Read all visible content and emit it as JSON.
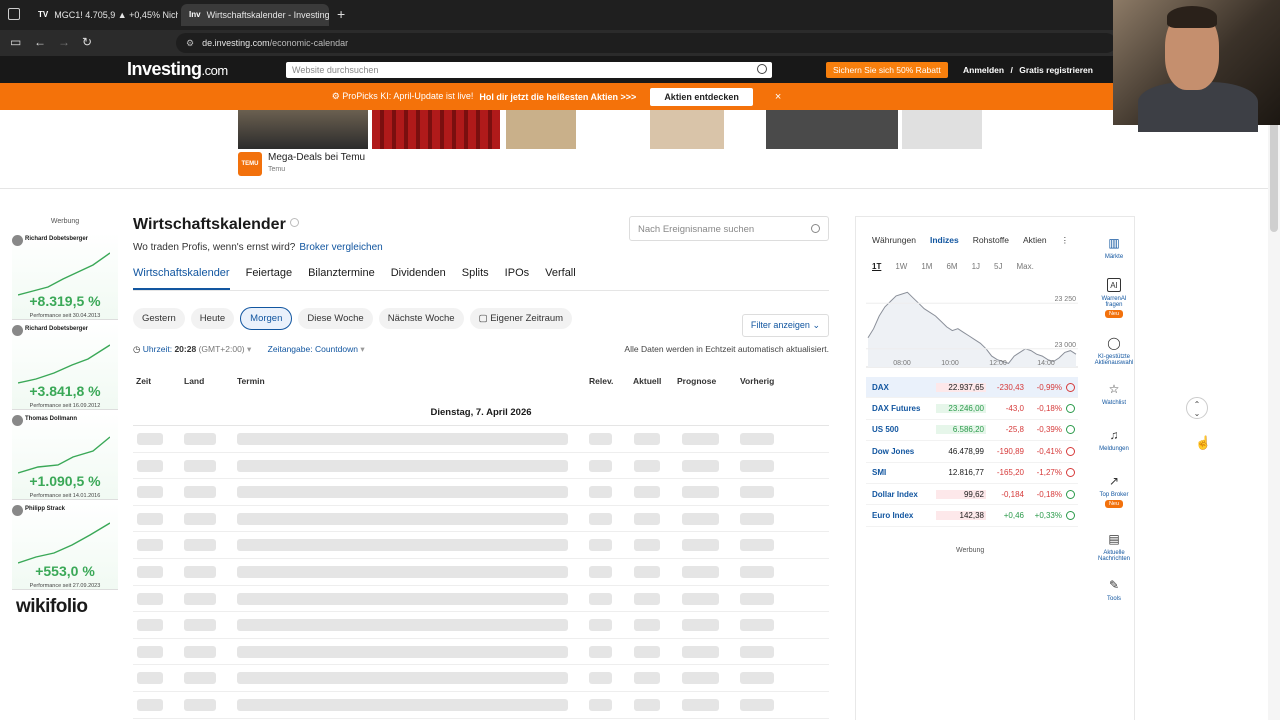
{
  "browser": {
    "tabs": [
      {
        "icon": "favicon-tab1",
        "title": "MGC1! 4.705,9 ▲ +0,45% Nicht"
      },
      {
        "icon": "investing-favicon",
        "title": "Wirtschaftskalender - Investing"
      }
    ],
    "new_tab": "+",
    "url_domain": "de.investing.com",
    "url_path": "/economic-calendar"
  },
  "site": {
    "logo_main": "Investing",
    "logo_suffix": ".com",
    "search_placeholder": "Website durchsuchen",
    "promo_button": "Sichern Sie sich 50% Rabatt",
    "login": "Anmelden",
    "login_sep": "/",
    "register": "Gratis registrieren"
  },
  "banner": {
    "text": "ProPicks KI: April-Update ist live!",
    "bold_text": "Hol dir jetzt die heißesten Aktien >>>",
    "cta": "Aktien entdecken",
    "close": "×"
  },
  "ad_top": {
    "logo_text": "TEMU",
    "title": "Mega-Deals bei Temu",
    "source": "Temu"
  },
  "left_ad": {
    "label": "Werbung",
    "cards": [
      {
        "name": "Richard Dobetsberger",
        "perf": "+8.319,5 %",
        "since": "Performance seit 30.04.2013"
      },
      {
        "name": "Richard Dobetsberger",
        "perf": "+3.841,8 %",
        "since": "Performance seit 16.09.2012"
      },
      {
        "name": "Thomas Dollmann",
        "perf": "+1.090,5 %",
        "since": "Performance seit 14.01.2016"
      },
      {
        "name": "Philipp Strack",
        "perf": "+553,0 %",
        "since": "Performance seit 27.09.2023"
      }
    ],
    "brand": "wikifolio"
  },
  "main": {
    "title": "Wirtschaftskalender",
    "question": "Wo traden Profis, wenn's ernst wird?",
    "broker_link": "Broker vergleichen",
    "search_placeholder": "Nach Ereignisname suchen",
    "subnav": [
      "Wirtschaftskalender",
      "Feiertage",
      "Bilanztermine",
      "Dividenden",
      "Splits",
      "IPOs",
      "Verfall"
    ],
    "date_filters": [
      "Gestern",
      "Heute",
      "Morgen",
      "Diese Woche",
      "Nächste Woche",
      "Eigener Zeitraum"
    ],
    "active_date_filter": "Morgen",
    "filter_button": "Filter anzeigen",
    "time_label": "Uhrzeit:",
    "time_value": "20:28",
    "timezone": "(GMT+2:00)",
    "display_label": "Zeitangabe:",
    "display_value": "Countdown",
    "realtime_note": "Alle Daten werden in Echtzeit automatisch aktualisiert.",
    "columns": [
      "Zeit",
      "Land",
      "Termin",
      "Relev.",
      "Aktuell",
      "Prognose",
      "Vorherig"
    ],
    "date_header": "Dienstag, 7. April 2026"
  },
  "markets": {
    "tabs": [
      "Währungen",
      "Indizes",
      "Rohstoffe",
      "Aktien"
    ],
    "active_tab": "Indizes",
    "ranges": [
      "1T",
      "1W",
      "1M",
      "6M",
      "1J",
      "5J",
      "Max."
    ],
    "active_range": "1T",
    "rows": [
      {
        "name": "DAX",
        "last": "22.937,65",
        "change": "-230,43",
        "pct": "-0,99%",
        "dir": "down",
        "status": "closed"
      },
      {
        "name": "DAX Futures",
        "last": "23.246,00",
        "change": "-43,0",
        "pct": "-0,18%",
        "dir": "up",
        "status": "open"
      },
      {
        "name": "US 500",
        "last": "6.586,20",
        "change": "-25,8",
        "pct": "-0,39%",
        "dir": "up",
        "status": "open"
      },
      {
        "name": "Dow Jones",
        "last": "46.478,99",
        "change": "-190,89",
        "pct": "-0,41%",
        "dir": "none",
        "status": "closed"
      },
      {
        "name": "SMI",
        "last": "12.816,77",
        "change": "-165,20",
        "pct": "-1,27%",
        "dir": "none",
        "status": "closed"
      },
      {
        "name": "Dollar Index",
        "last": "99,62",
        "change": "-0,184",
        "pct": "-0,18%",
        "dir": "down",
        "status": "open"
      },
      {
        "name": "Euro Index",
        "last": "142,38",
        "change": "+0,46",
        "pct": "+0,33%",
        "dir": "down",
        "status": "open"
      }
    ],
    "ad_label": "Werbung"
  },
  "chart_data": {
    "type": "line",
    "title": "",
    "x": [
      "08:00",
      "10:00",
      "12:00",
      "14:00"
    ],
    "y_ticks": [
      23250,
      23000
    ],
    "ylim": [
      22900,
      23350
    ],
    "values": [
      23060,
      23110,
      23180,
      23230,
      23260,
      23290,
      23300,
      23310,
      23280,
      23250,
      23220,
      23200,
      23180,
      23150,
      23120,
      23100,
      23110,
      23090,
      23070,
      23050,
      23030,
      23000,
      22960,
      22940,
      22930,
      22920,
      22960,
      22980,
      23000,
      22990,
      22970,
      22960,
      22940,
      22930,
      22950,
      22980,
      22990,
      22970
    ]
  },
  "toolbar": {
    "items": [
      {
        "icon": "bar-chart-icon",
        "label": "Märkte",
        "badge": ""
      },
      {
        "icon": "ai-icon",
        "label": "WarrenAI fragen",
        "badge": "Neu"
      },
      {
        "icon": "lightbulb-icon",
        "label": "KI-gestützte Aktienauswahl",
        "badge": ""
      },
      {
        "icon": "star-icon",
        "label": "Watchlist",
        "badge": ""
      },
      {
        "icon": "bell-icon",
        "label": "Meldungen",
        "badge": ""
      },
      {
        "icon": "trend-icon",
        "label": "Top Broker",
        "badge": "Neu"
      },
      {
        "icon": "news-icon",
        "label": "Aktuelle Nachrichten",
        "badge": ""
      },
      {
        "icon": "wrench-icon",
        "label": "Tools",
        "badge": ""
      }
    ]
  }
}
